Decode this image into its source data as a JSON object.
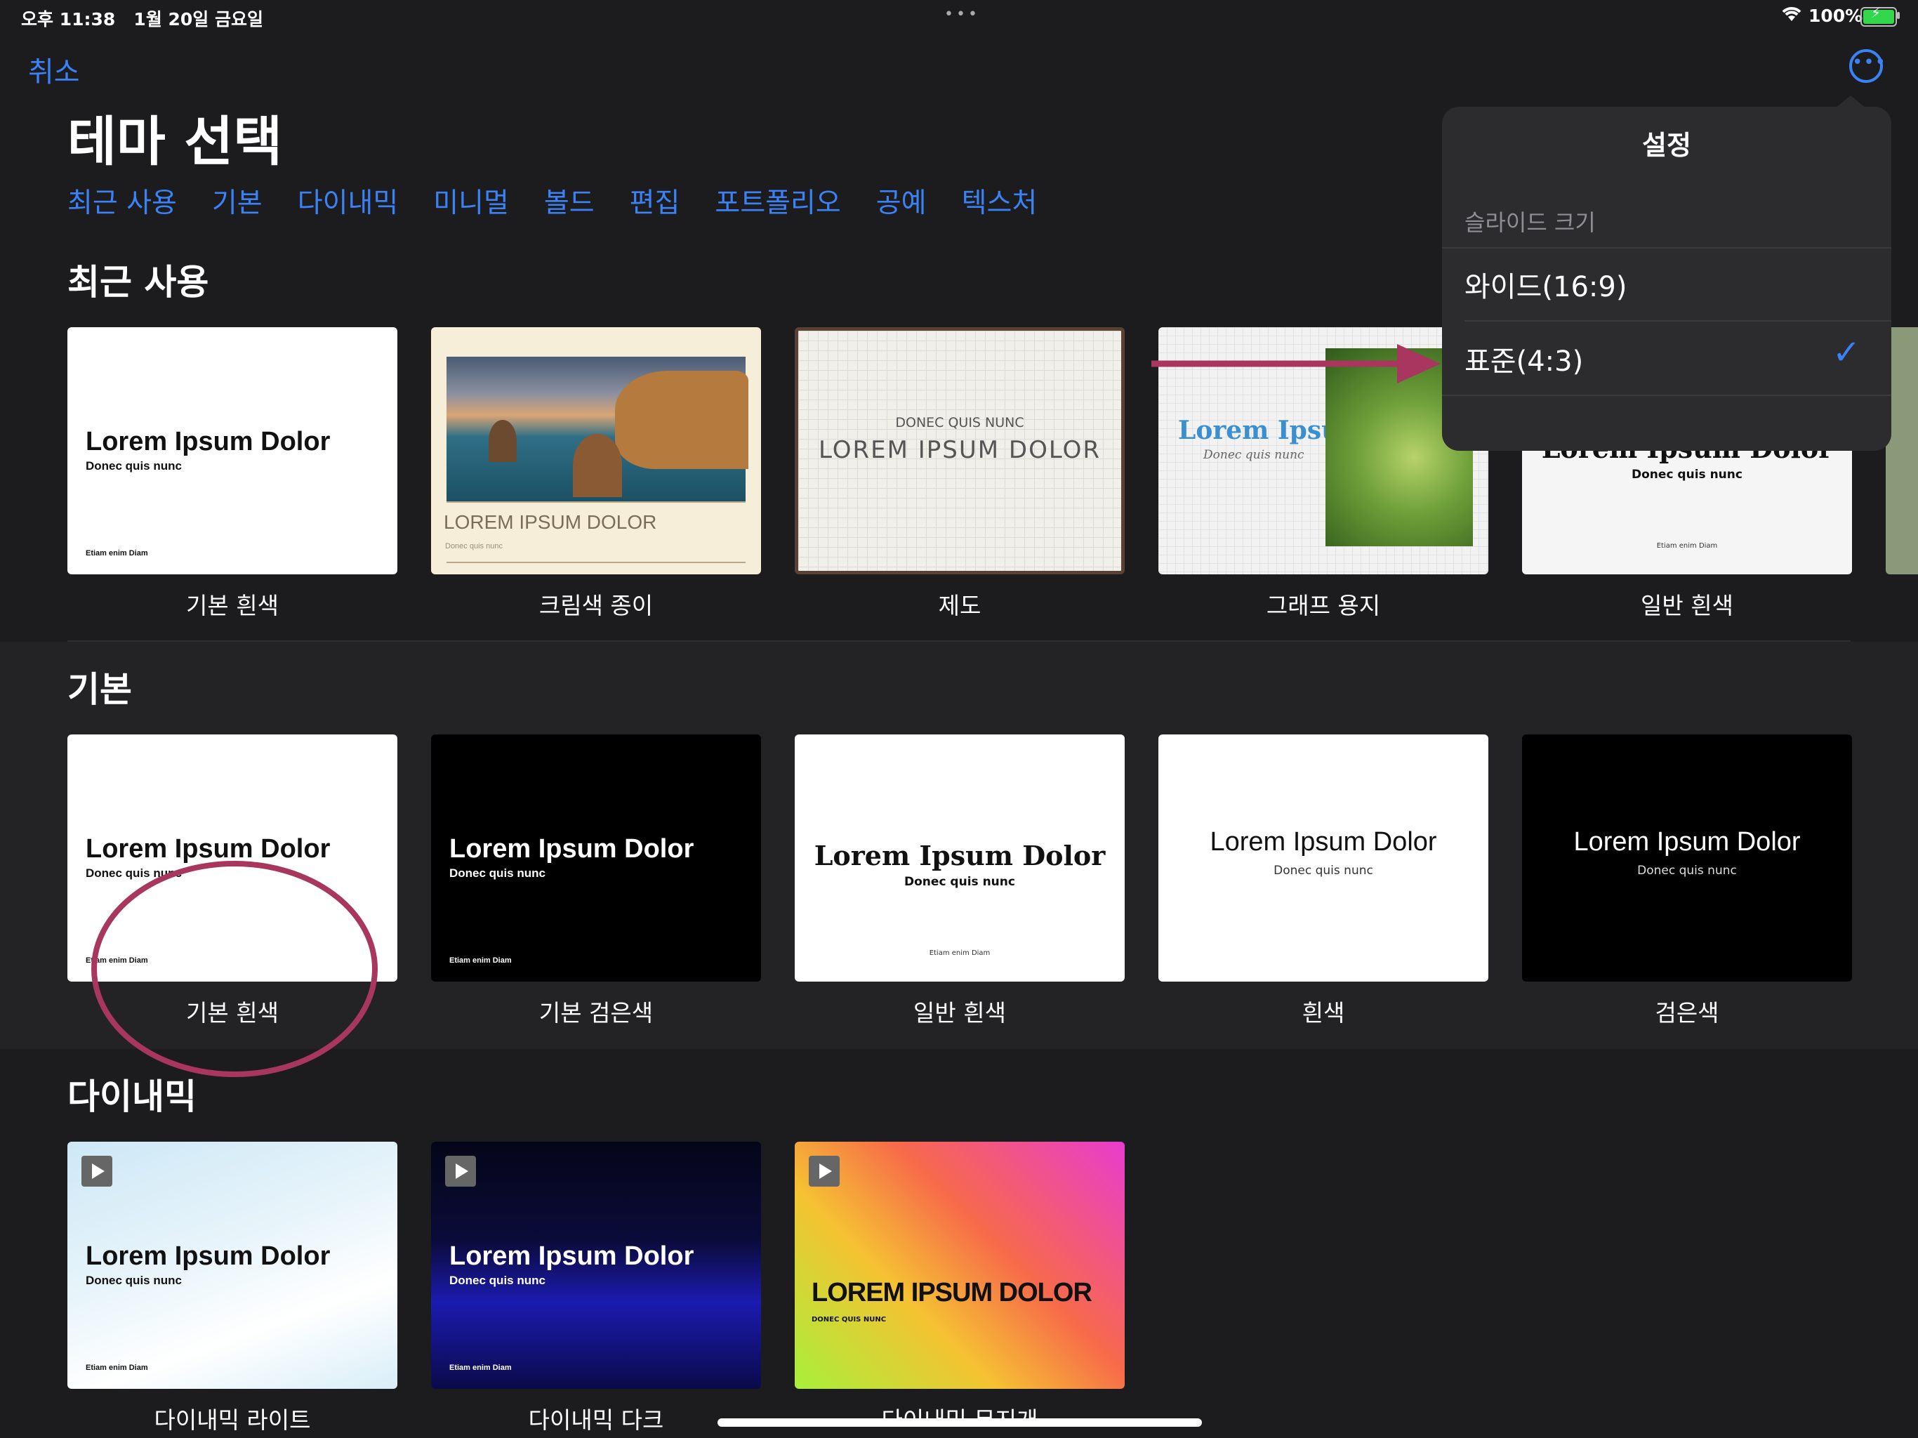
{
  "status_bar": {
    "time": "오후 11:38",
    "date": "1월 20일 금요일",
    "dots": "•••",
    "battery": "100%"
  },
  "nav": {
    "cancel_label": "취소",
    "more_icon": "ellipsis-circle-icon"
  },
  "page_title": "테마 선택",
  "tabs": [
    "최근 사용",
    "기본",
    "다이내믹",
    "미니멀",
    "볼드",
    "편집",
    "포트폴리오",
    "공예",
    "텍스처"
  ],
  "sections": {
    "recent": {
      "title": "최근 사용",
      "items": [
        "기본 흰색",
        "크림색 종이",
        "제도",
        "그래프 용지",
        "일반 흰색"
      ]
    },
    "basic": {
      "title": "기본",
      "items": [
        "기본 흰색",
        "기본 검은색",
        "일반 흰색",
        "흰색",
        "검은색"
      ]
    },
    "dynamic": {
      "title": "다이내믹",
      "items": [
        "다이내믹 라이트",
        "다이내믹 다크",
        "다이내믹 무지개"
      ]
    }
  },
  "thumb_text": {
    "lorem": "Lorem Ipsum Dolor",
    "lorem_upper": "LOREM IPSUM DOLOR",
    "lorem_short": "Lorem Ipsum",
    "donec": "Donec quis nunc",
    "donec_upper": "DONEC QUIS NUNC",
    "etiam": "Etiam enim Diam"
  },
  "settings_popover": {
    "title": "설정",
    "section_label": "슬라이드 크기",
    "options": [
      "와이드(16:9)",
      "표준(4:3)"
    ],
    "selected_index": 1
  },
  "colors": {
    "accent": "#3b82f6",
    "annotation": "#a8365e"
  }
}
